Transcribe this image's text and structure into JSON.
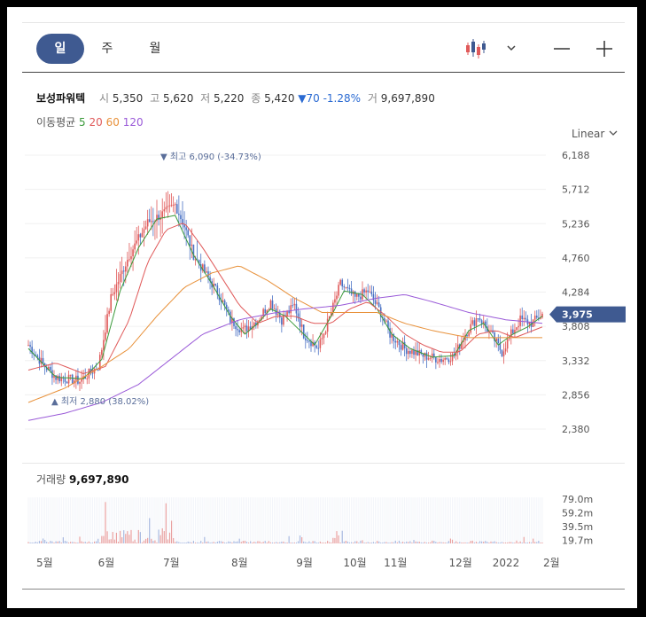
{
  "tabs": [
    "일",
    "주",
    "월"
  ],
  "active_tab": 0,
  "quote": {
    "name": "보성파워텍",
    "open_label": "시",
    "open": "5,350",
    "high_label": "고",
    "high": "5,620",
    "low_label": "저",
    "low": "5,220",
    "close_label": "종",
    "close": "5,420",
    "change": "▼70 -1.28%",
    "volume_label": "거",
    "volume": "9,697,890"
  },
  "moving_average": {
    "label": "이동평균",
    "periods": [
      {
        "label": "5",
        "color": "#3a9a3a"
      },
      {
        "label": "20",
        "color": "#e05a5a"
      },
      {
        "label": "60",
        "color": "#e8913a"
      },
      {
        "label": "120",
        "color": "#9a5ad8"
      }
    ]
  },
  "scale_mode": "Linear",
  "icons": {
    "chart_type": "candlestick-icon",
    "dropdown": "chevron-down-icon",
    "zoom_out": "minus-icon",
    "zoom_in": "plus-icon"
  },
  "chart_data": {
    "type": "candlestick",
    "y_ticks": [
      "6,188",
      "5,712",
      "5,236",
      "4,760",
      "4,284",
      "3,808",
      "3,332",
      "2,856",
      "2,380"
    ],
    "ylim": [
      2380,
      6188
    ],
    "x_ticks": [
      "5월",
      "6월",
      "7월",
      "8월",
      "9월",
      "10월",
      "11월",
      "12월",
      "2022",
      "2월"
    ],
    "current_price": "3,975",
    "max_annotation": "최고 6,090 (-34.73%)",
    "min_annotation": "최저 2,880 (38.02%)",
    "volume_title": "거래량",
    "volume_value": "9,697,890",
    "volume_ticks": [
      "79.0m",
      "59.2m",
      "39.5m",
      "19.7m"
    ],
    "close_anchors": [
      [
        0,
        3550
      ],
      [
        8,
        3280
      ],
      [
        15,
        3100
      ],
      [
        28,
        3050
      ],
      [
        38,
        3250
      ],
      [
        40,
        3500
      ],
      [
        45,
        4200
      ],
      [
        55,
        4800
      ],
      [
        65,
        5250
      ],
      [
        75,
        5400
      ],
      [
        80,
        5500
      ],
      [
        85,
        5200
      ],
      [
        90,
        4800
      ],
      [
        95,
        4600
      ],
      [
        105,
        4200
      ],
      [
        110,
        3900
      ],
      [
        117,
        3750
      ],
      [
        125,
        3900
      ],
      [
        132,
        4150
      ],
      [
        138,
        3900
      ],
      [
        145,
        4100
      ],
      [
        150,
        3700
      ],
      [
        158,
        3500
      ],
      [
        165,
        4000
      ],
      [
        170,
        4400
      ],
      [
        178,
        4200
      ],
      [
        185,
        4300
      ],
      [
        192,
        4000
      ],
      [
        197,
        3700
      ],
      [
        205,
        3500
      ],
      [
        215,
        3400
      ],
      [
        225,
        3350
      ],
      [
        232,
        3400
      ],
      [
        238,
        3700
      ],
      [
        245,
        3950
      ],
      [
        252,
        3700
      ],
      [
        258,
        3450
      ],
      [
        263,
        3700
      ],
      [
        268,
        3900
      ],
      [
        274,
        3850
      ],
      [
        280,
        3975
      ]
    ],
    "ma_series": [
      {
        "name": "5",
        "color": "#3a9a3a",
        "points": [
          [
            0,
            3500
          ],
          [
            15,
            3100
          ],
          [
            30,
            3080
          ],
          [
            40,
            3350
          ],
          [
            50,
            4300
          ],
          [
            60,
            4900
          ],
          [
            70,
            5300
          ],
          [
            80,
            5350
          ],
          [
            90,
            4800
          ],
          [
            100,
            4400
          ],
          [
            110,
            3950
          ],
          [
            118,
            3700
          ],
          [
            125,
            3850
          ],
          [
            132,
            4050
          ],
          [
            140,
            3950
          ],
          [
            148,
            3750
          ],
          [
            156,
            3550
          ],
          [
            165,
            3950
          ],
          [
            172,
            4300
          ],
          [
            182,
            4250
          ],
          [
            190,
            4050
          ],
          [
            198,
            3700
          ],
          [
            208,
            3500
          ],
          [
            220,
            3380
          ],
          [
            232,
            3400
          ],
          [
            240,
            3750
          ],
          [
            248,
            3850
          ],
          [
            256,
            3550
          ],
          [
            264,
            3700
          ],
          [
            272,
            3800
          ],
          [
            280,
            3950
          ]
        ]
      },
      {
        "name": "20",
        "color": "#e05a5a",
        "points": [
          [
            0,
            3200
          ],
          [
            15,
            3300
          ],
          [
            30,
            3150
          ],
          [
            42,
            3250
          ],
          [
            55,
            3900
          ],
          [
            65,
            4700
          ],
          [
            75,
            5150
          ],
          [
            85,
            5250
          ],
          [
            95,
            4900
          ],
          [
            105,
            4500
          ],
          [
            115,
            4100
          ],
          [
            125,
            3850
          ],
          [
            135,
            3950
          ],
          [
            145,
            3950
          ],
          [
            155,
            3850
          ],
          [
            165,
            3850
          ],
          [
            175,
            4050
          ],
          [
            185,
            4150
          ],
          [
            195,
            3950
          ],
          [
            205,
            3700
          ],
          [
            215,
            3550
          ],
          [
            225,
            3450
          ],
          [
            235,
            3450
          ],
          [
            245,
            3700
          ],
          [
            255,
            3750
          ],
          [
            265,
            3650
          ],
          [
            280,
            3800
          ]
        ]
      },
      {
        "name": "60",
        "color": "#e8913a",
        "points": [
          [
            0,
            2750
          ],
          [
            20,
            2950
          ],
          [
            40,
            3250
          ],
          [
            55,
            3500
          ],
          [
            70,
            3950
          ],
          [
            85,
            4350
          ],
          [
            100,
            4550
          ],
          [
            115,
            4650
          ],
          [
            130,
            4450
          ],
          [
            145,
            4200
          ],
          [
            160,
            4000
          ],
          [
            175,
            4000
          ],
          [
            190,
            4000
          ],
          [
            205,
            3850
          ],
          [
            220,
            3750
          ],
          [
            240,
            3650
          ],
          [
            260,
            3650
          ],
          [
            280,
            3650
          ]
        ]
      },
      {
        "name": "120",
        "color": "#9a5ad8",
        "points": [
          [
            0,
            2500
          ],
          [
            20,
            2600
          ],
          [
            40,
            2750
          ],
          [
            60,
            3000
          ],
          [
            75,
            3300
          ],
          [
            95,
            3700
          ],
          [
            115,
            3900
          ],
          [
            135,
            4000
          ],
          [
            150,
            4050
          ],
          [
            170,
            4100
          ],
          [
            190,
            4200
          ],
          [
            205,
            4250
          ],
          [
            220,
            4150
          ],
          [
            240,
            4000
          ],
          [
            260,
            3900
          ],
          [
            280,
            3850
          ]
        ]
      }
    ]
  }
}
